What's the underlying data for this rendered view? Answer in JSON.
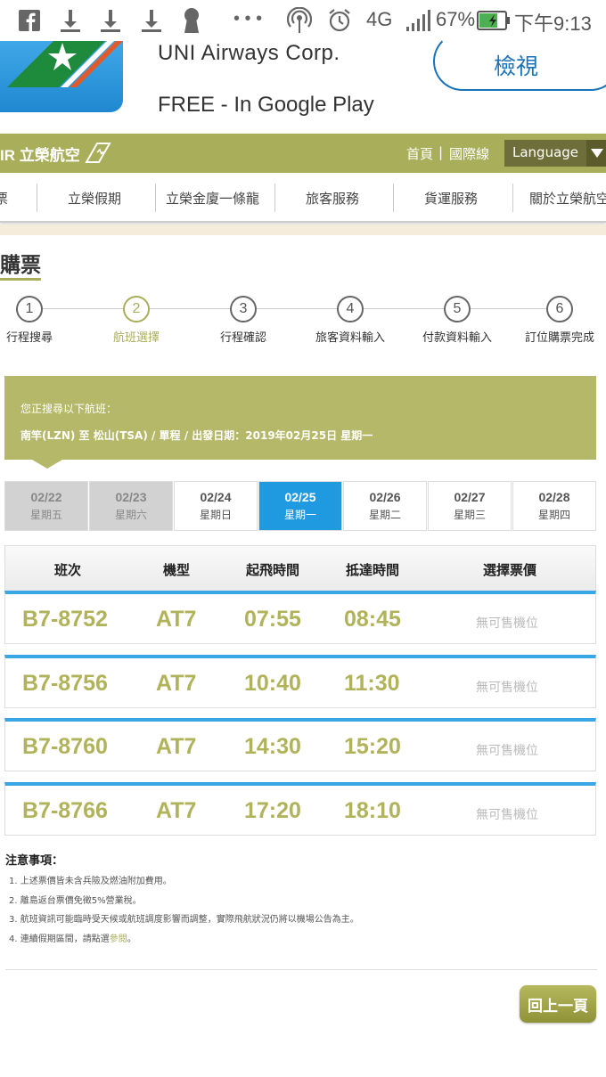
{
  "status_bar": {
    "network": "4G",
    "battery": "67%",
    "time": "下午9:13",
    "icons": [
      "facebook-icon",
      "download-icon",
      "download-icon",
      "download-icon",
      "keyhole-icon",
      "more-icon",
      "hotspot-icon",
      "alarm-icon",
      "signal-icon",
      "battery-icon"
    ]
  },
  "app_banner": {
    "name": "UNI Airways Corp.",
    "price": "FREE - In Google Play",
    "view_label": "檢視"
  },
  "site_header": {
    "logo_text": "IR 立榮航空",
    "links": [
      "首頁",
      "國際線"
    ],
    "language_label": "Language"
  },
  "main_nav": {
    "items": [
      "票",
      "立榮假期",
      "立榮金廈一條龍",
      "旅客服務",
      "貨運服務",
      "關於立榮航空"
    ]
  },
  "page": {
    "title": "購票"
  },
  "steps": [
    {
      "num": "1",
      "label": "行程搜尋"
    },
    {
      "num": "2",
      "label": "航班選擇"
    },
    {
      "num": "3",
      "label": "行程確認"
    },
    {
      "num": "4",
      "label": "旅客資料輸入"
    },
    {
      "num": "5",
      "label": "付款資料輸入"
    },
    {
      "num": "6",
      "label": "訂位購票完成"
    }
  ],
  "search": {
    "prefix": "您正搜尋以下航班：",
    "info": "南竿(LZN)  至  松山(TSA)  /  單程  /  出發日期：2019年02月25日 星期一"
  },
  "dates": [
    {
      "date": "02/22",
      "day": "星期五"
    },
    {
      "date": "02/23",
      "day": "星期六"
    },
    {
      "date": "02/24",
      "day": "星期日"
    },
    {
      "date": "02/25",
      "day": "星期一"
    },
    {
      "date": "02/26",
      "day": "星期二"
    },
    {
      "date": "02/27",
      "day": "星期三"
    },
    {
      "date": "02/28",
      "day": "星期四"
    }
  ],
  "table": {
    "headers": [
      "班次",
      "機型",
      "起飛時間",
      "抵達時間",
      "選擇票價"
    ],
    "rows": [
      {
        "flight": "B7-8752",
        "aircraft": "AT7",
        "depart": "07:55",
        "arrive": "08:45",
        "fare": "無可售機位"
      },
      {
        "flight": "B7-8756",
        "aircraft": "AT7",
        "depart": "10:40",
        "arrive": "11:30",
        "fare": "無可售機位"
      },
      {
        "flight": "B7-8760",
        "aircraft": "AT7",
        "depart": "14:30",
        "arrive": "15:20",
        "fare": "無可售機位"
      },
      {
        "flight": "B7-8766",
        "aircraft": "AT7",
        "depart": "17:20",
        "arrive": "18:10",
        "fare": "無可售機位"
      }
    ]
  },
  "notes": {
    "title": "注意事項：",
    "items": [
      "1. 上述票價皆未含兵險及燃油附加費用。",
      "2. 離島返台票價免徵5%營業稅。",
      "3. 航班資訊可能臨時受天候或航班調度影響而調整，實際飛航狀況仍將以機場公告為主。"
    ],
    "item4_prefix": "4. 連續假期區間，請點選",
    "item4_link": "參閱",
    "item4_suffix": "。"
  },
  "back_button": "回上一頁",
  "colors": {
    "brand_olive": "#a8ae5a",
    "active_blue": "#1f9ae0",
    "row_accent": "#3aa6e6",
    "view_blue": "#1a73b8"
  }
}
